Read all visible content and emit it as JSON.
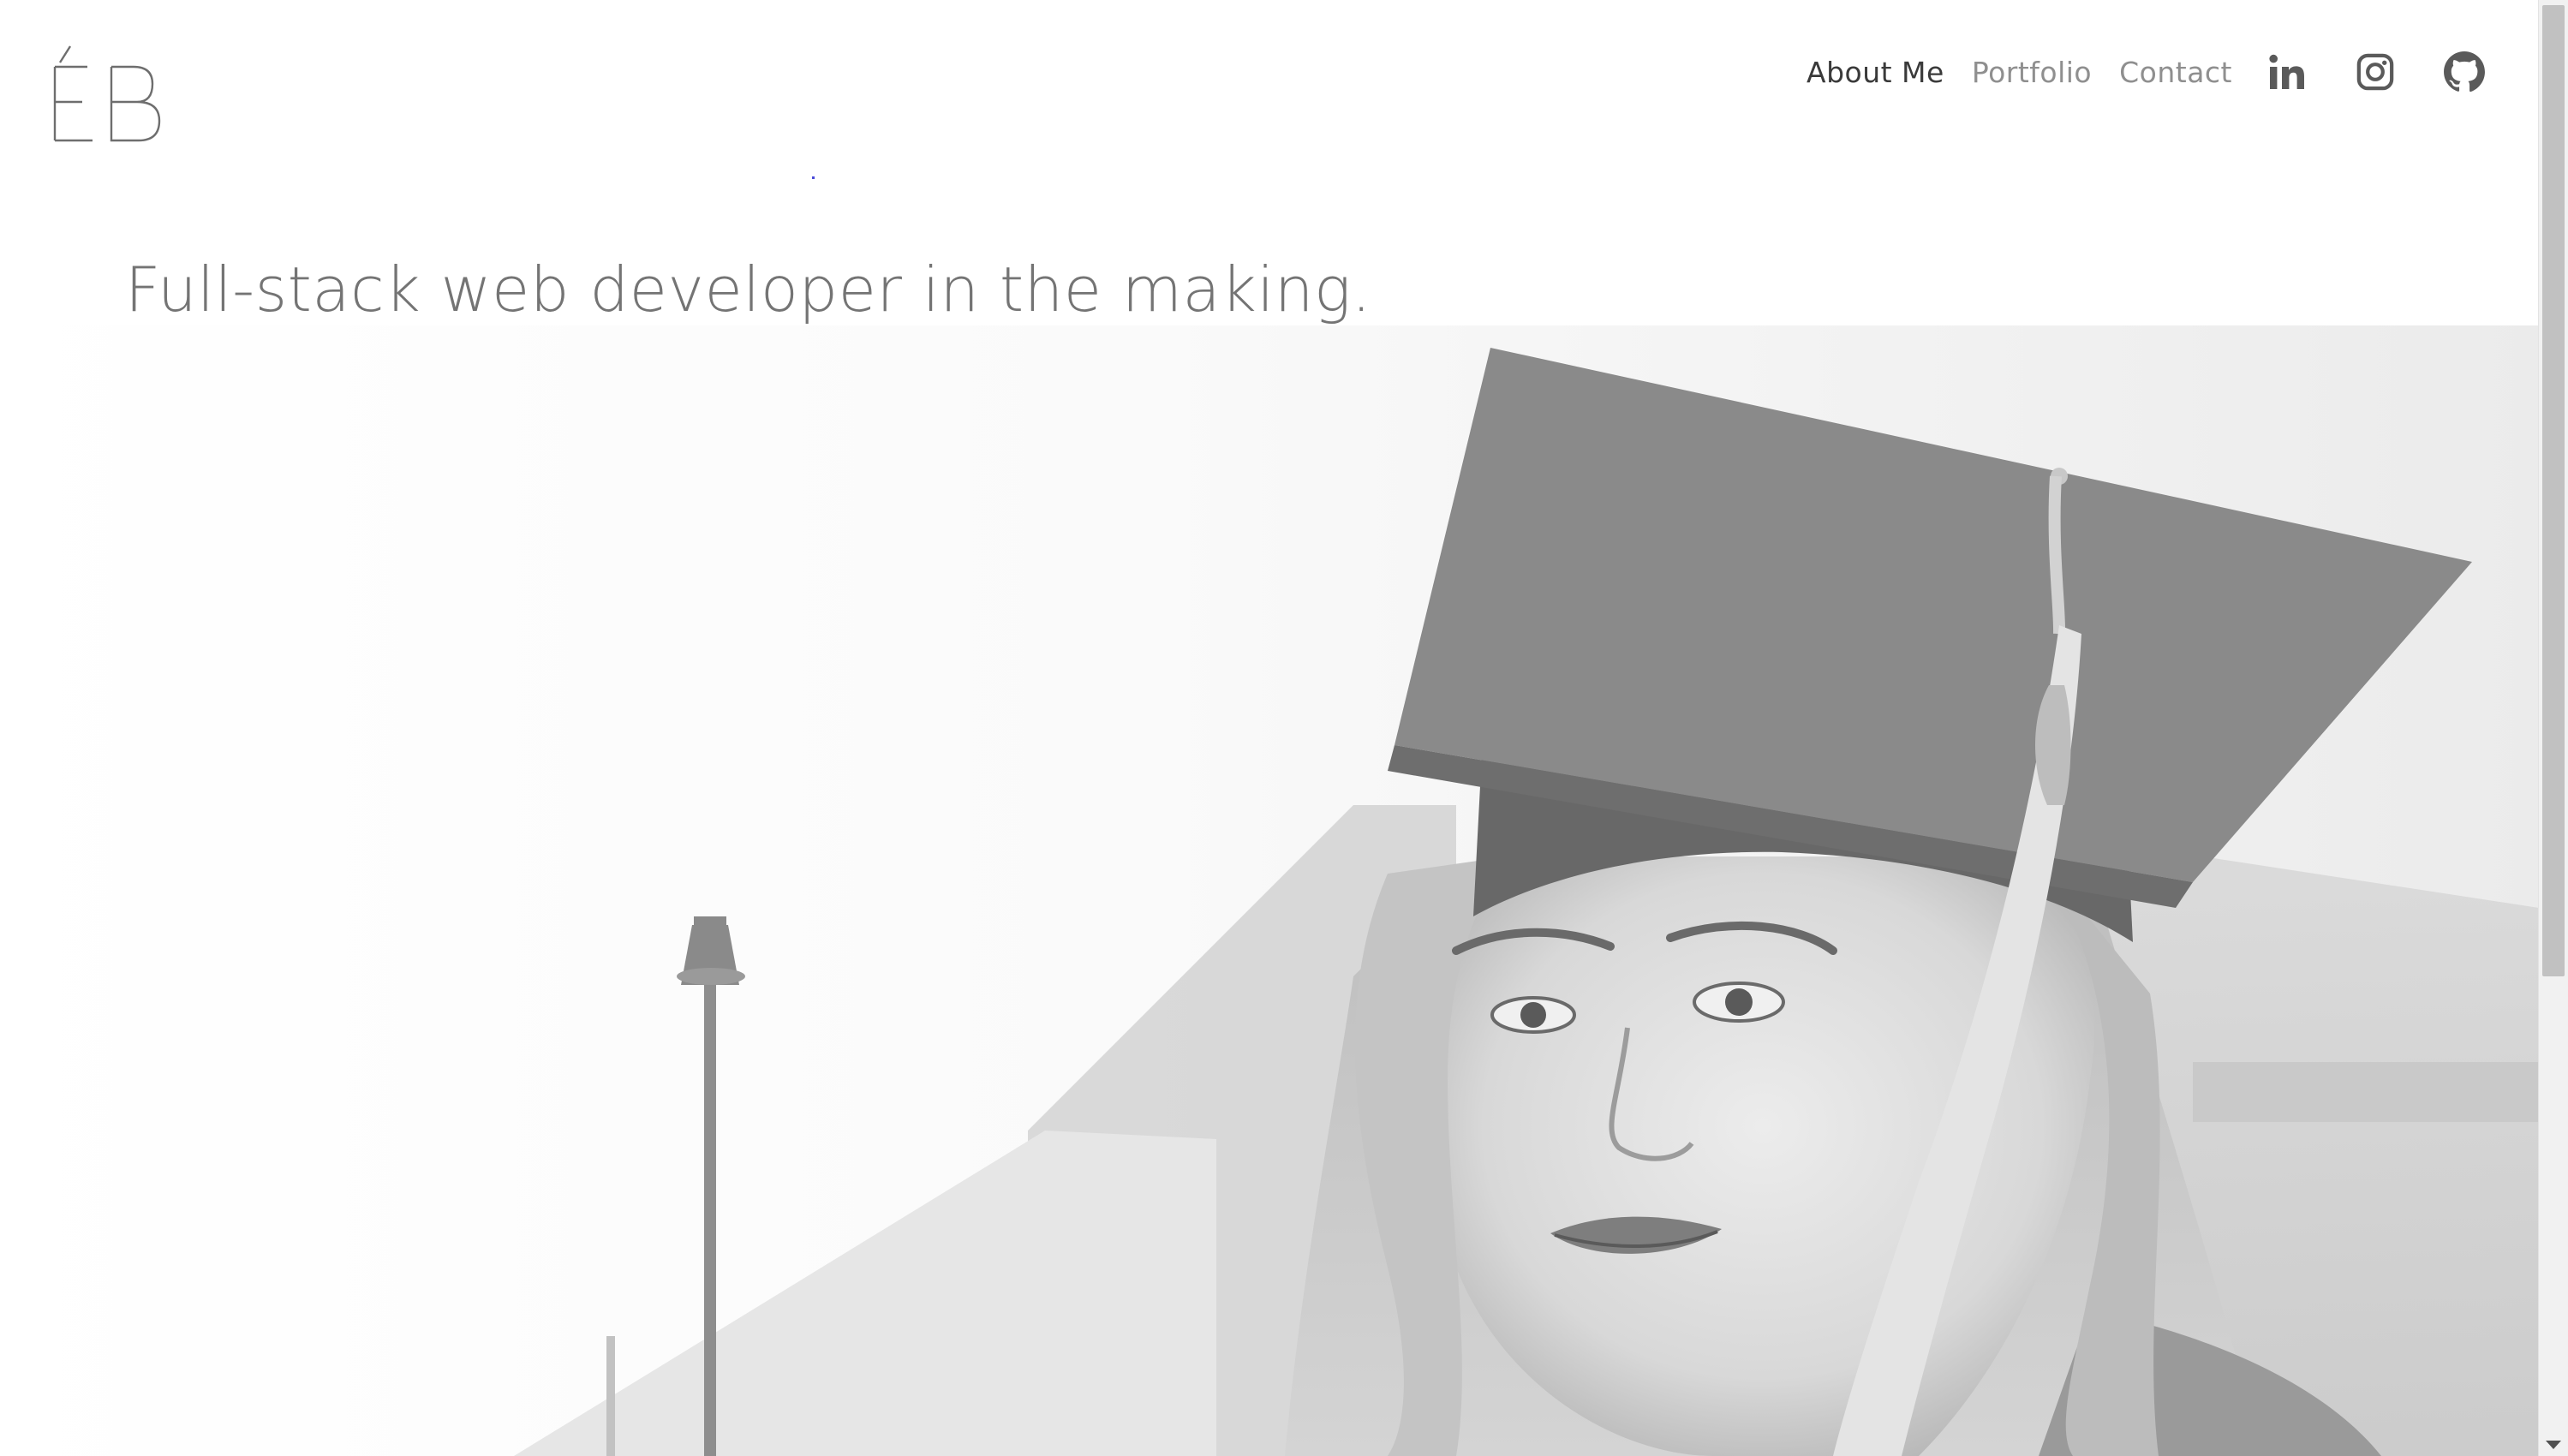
{
  "logo": {
    "text": "ÉB"
  },
  "nav": {
    "items": [
      {
        "label": "About Me",
        "active": true
      },
      {
        "label": "Portfolio",
        "active": false
      },
      {
        "label": "Contact",
        "active": false
      }
    ]
  },
  "social": {
    "icons": [
      "linkedin-icon",
      "instagram-icon",
      "github-icon"
    ]
  },
  "hero": {
    "headline": "Full-stack web developer in the making.",
    "image_alt": "graduation-portrait"
  },
  "colors": {
    "nav_active": "#3a3a3a",
    "nav_inactive": "#8f8f8f",
    "headline": "#747474",
    "icon": "#5a5a5a"
  }
}
